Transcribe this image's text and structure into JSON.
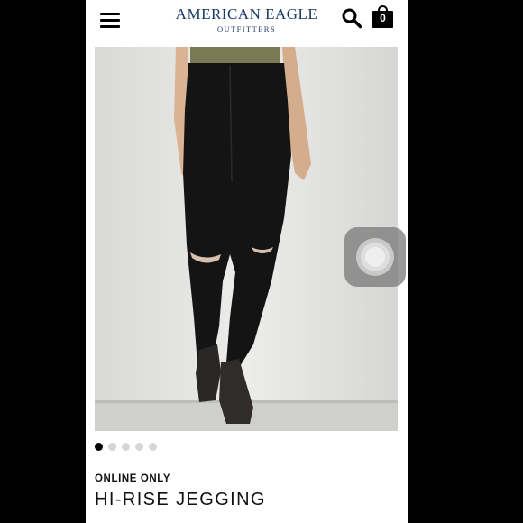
{
  "header": {
    "brand": "AMERICAN EAGLE",
    "brand_sub": "OUTFITTERS",
    "menu_icon": "hamburger-menu-icon",
    "search_icon": "search-icon",
    "bag_icon": "shopping-bag-icon",
    "bag_count": "0"
  },
  "carousel": {
    "total": 5,
    "active_index": 0
  },
  "product": {
    "tag": "ONLINE ONLY",
    "title": "HI-RISE JEGGING",
    "colors": {
      "jeans": "#141414",
      "top": "#7b7a55",
      "background": "#e4e4e2"
    }
  },
  "overlay": {
    "assistive_touch_icon": "assistive-touch-icon"
  }
}
